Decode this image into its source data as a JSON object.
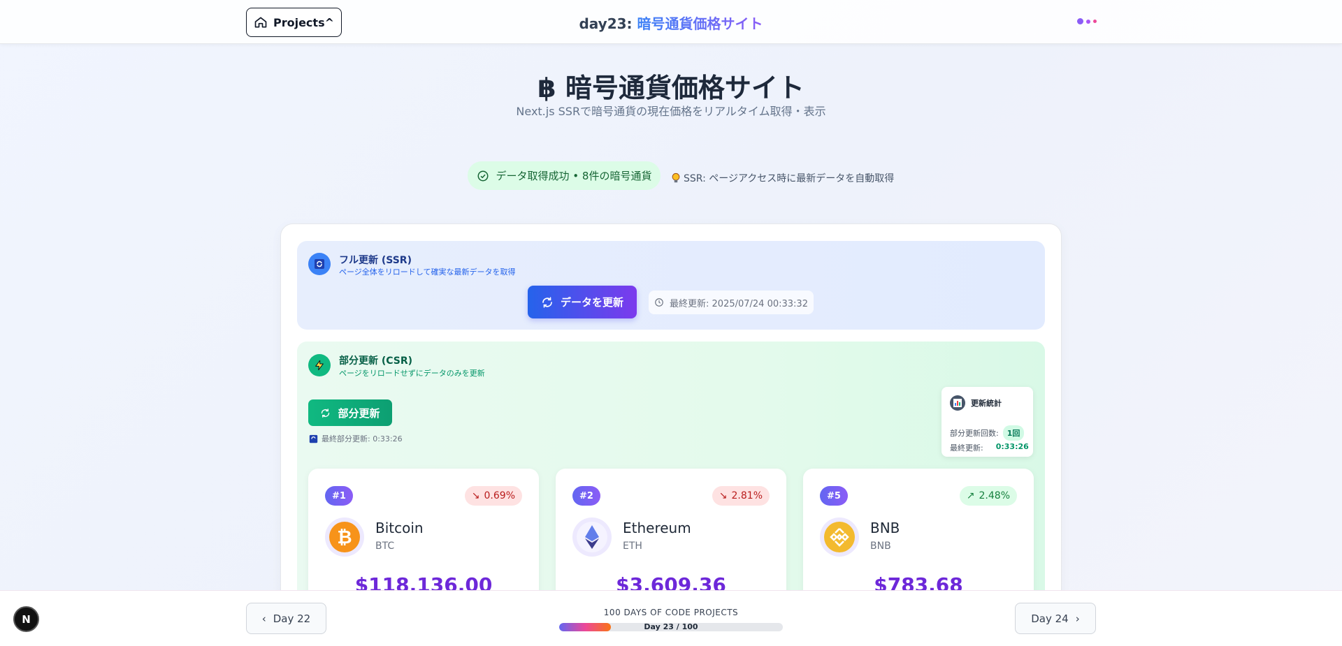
{
  "header": {
    "projects_label": "Projects",
    "title_prefix": "day23: ",
    "title_name": "暗号通貨価格サイト",
    "dot_colors": [
      "#8b5cf6",
      "#a855f7",
      "#ec4899"
    ]
  },
  "hero": {
    "title": "暗号通貨価格サイト",
    "subtitle": "Next.js SSRで暗号通貨の現在価格をリアルタイム取得・表示",
    "status": "データ取得成功 • 8件の暗号通貨",
    "ssr_note": "SSR: ページアクセス時に最新データを自動取得"
  },
  "ssr_panel": {
    "title": "フル更新 (SSR)",
    "desc": "ページ全体をリロードして確実な最新データを取得",
    "button": "データを更新",
    "last_update": "最終更新: 2025/07/24 00:33:32"
  },
  "csr_panel": {
    "title": "部分更新 (CSR)",
    "desc": "ページをリロードせずにデータのみを更新",
    "button": "部分更新",
    "last_partial": "最終部分更新: 0:33:26",
    "stats": {
      "title": "更新統計",
      "count_label": "部分更新回数:",
      "count_value": "1回",
      "last_label": "最終更新:",
      "last_value": "0:33:26"
    }
  },
  "coins": [
    {
      "rank": "#1",
      "change": "0.69%",
      "direction": "down",
      "name": "Bitcoin",
      "symbol": "BTC",
      "price": "$118,136.00",
      "color": "#f7931a"
    },
    {
      "rank": "#2",
      "change": "2.81%",
      "direction": "down",
      "name": "Ethereum",
      "symbol": "ETH",
      "price": "$3,609.36",
      "color": "#627eea"
    },
    {
      "rank": "#5",
      "change": "2.48%",
      "direction": "up",
      "name": "BNB",
      "symbol": "BNB",
      "price": "$783.68",
      "color": "#f3ba2f"
    }
  ],
  "footer": {
    "prev": "Day 22",
    "next": "Day 24",
    "progress_title": "100 DAYS OF CODE PROJECTS",
    "progress_text": "Day 23 / 100",
    "progress": 0.23,
    "badge": "N"
  }
}
